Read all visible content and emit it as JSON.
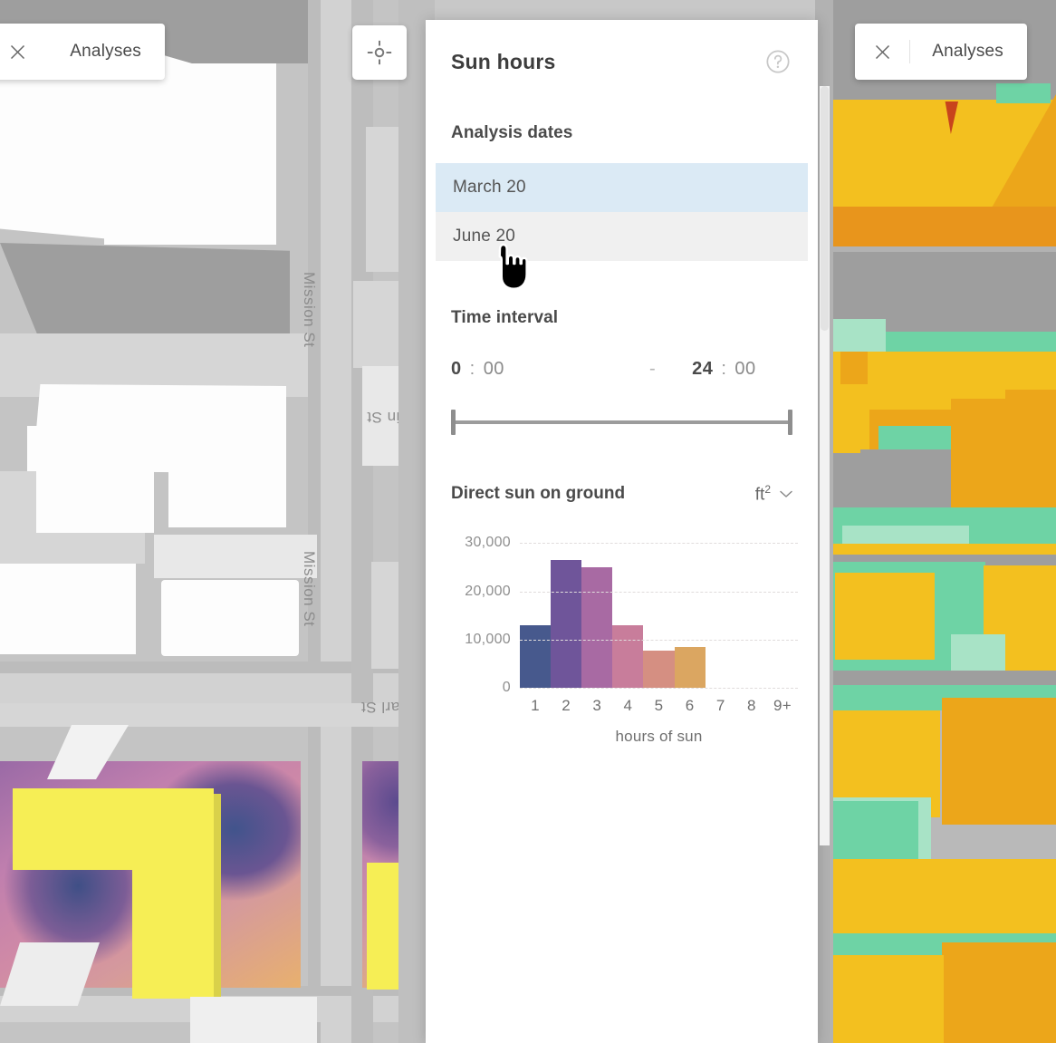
{
  "top_bar": {
    "left_button": {
      "label": "Analyses",
      "close_icon": "close-icon"
    },
    "right_button": {
      "label": "Analyses",
      "close_icon": "close-icon"
    },
    "locate_button": {
      "icon": "crosshair-locate-icon"
    }
  },
  "panel": {
    "title": "Sun hours",
    "help_icon": "help-circle-icon",
    "analysis_dates": {
      "title": "Analysis dates",
      "items": [
        {
          "label": "March 20",
          "state": "selected"
        },
        {
          "label": "June 20",
          "state": "hovered"
        }
      ]
    },
    "time_interval": {
      "title": "Time interval",
      "start_hour": "0",
      "start_sep": ":",
      "start_minute": "00",
      "dash": "-",
      "end_hour": "24",
      "end_sep": ":",
      "end_minute": "00",
      "slider": {
        "min": 0,
        "max": 24,
        "value_low": 0,
        "value_high": 24
      }
    },
    "chart_section": {
      "title": "Direct sun on ground",
      "unit_label": "ft",
      "unit_exponent": "2",
      "unit_caret": "chevron-down-icon"
    }
  },
  "map": {
    "street_labels": [
      {
        "name": "Mission St"
      },
      {
        "name": "Mission St"
      },
      {
        "name": "Main St"
      },
      {
        "name": "Pearl St"
      }
    ]
  },
  "chart_data": {
    "type": "bar",
    "title": "Direct sun on ground",
    "xlabel": "hours of sun",
    "ylabel": "",
    "unit": "ft2",
    "categories": [
      "1",
      "2",
      "3",
      "4",
      "5",
      "6",
      "7",
      "8",
      "9+"
    ],
    "values": [
      13000,
      26500,
      25000,
      13000,
      7800,
      8500,
      0,
      0,
      0
    ],
    "colors": [
      "#47598d",
      "#6f559a",
      "#a86aa3",
      "#c87d9b",
      "#d58f82",
      "#dba661",
      "#dba661",
      "#dba661",
      "#dba661"
    ],
    "ylim": [
      0,
      30000
    ],
    "yticks": [
      0,
      10000,
      20000,
      30000
    ],
    "ytick_labels": [
      "0",
      "10,000",
      "20,000",
      "30,000"
    ],
    "grid": true,
    "legend": false
  }
}
